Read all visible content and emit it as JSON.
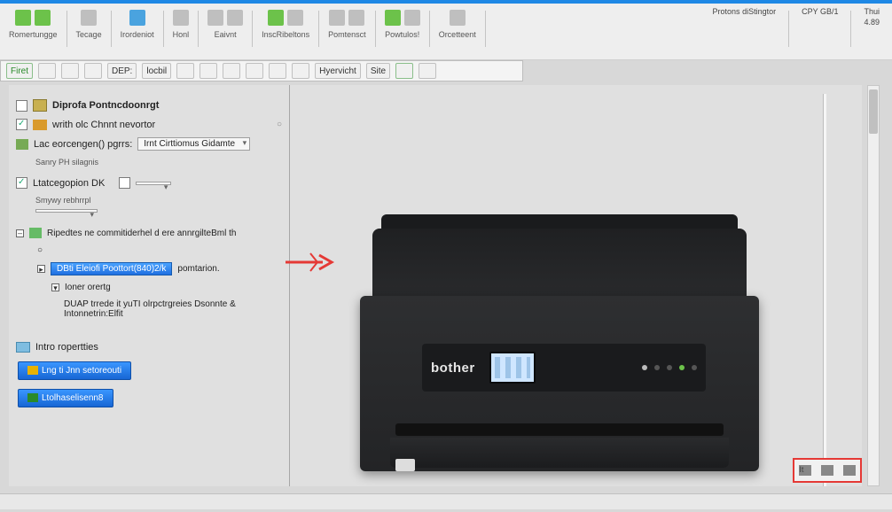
{
  "ribbon1": {
    "groups": [
      {
        "label": "Romertungge"
      },
      {
        "label": "Tecage"
      },
      {
        "label": "Irordeniot"
      },
      {
        "label": "Honl"
      },
      {
        "label": "Eaivnt"
      },
      {
        "label": "InscRibeltons"
      },
      {
        "label": "Pomtensct"
      },
      {
        "label": "Powtulos!"
      },
      {
        "label": "Orcetteent"
      }
    ],
    "right_fields": [
      {
        "k": "Protons",
        "v": "diStingtor"
      },
      {
        "k": "CPY",
        "v": "GB/1"
      },
      {
        "k": "Thui",
        "v": "4.89"
      }
    ]
  },
  "ribbon2": {
    "items": [
      "Firet",
      "",
      "",
      "",
      "DEP:",
      "locbil",
      "",
      "",
      "",
      "",
      "",
      "",
      "Hyervicht",
      "Site",
      ""
    ]
  },
  "panel": {
    "header": "Diprofa Pontncdoonrgt",
    "l1": "writh olc Chnnt nevortor",
    "l2": "Lac eorcengen() pgrrs:",
    "l2_sub": "Sanry PH silagnis",
    "l2_dd": "Irnt Cirttiomus Gidamte",
    "l3": "Ltatcegopion DK",
    "l3_sub": "Smywy rebhrrpl",
    "tree_head": "Ripedtes ne commitiderhel d ere annrgilteBml th",
    "tree_sel": "DBti Eleiofi Poottort(840)2/k",
    "tree_sel_tail": "pomtarion.",
    "tree_sub1": "Ioner orertg",
    "tree_sub2": "DUAP trrede it yuTI olrpctrgreies Dsonnte &",
    "tree_sub3": "Intonnetrin:Elfit",
    "info": "Intro ropertties",
    "btn1": "Lng ti Jnn setoreouti",
    "btn2": "Ltolhaselisenn8"
  },
  "printer": {
    "brand": "bother"
  },
  "br": {
    "a": "It",
    "b": "",
    "c": ""
  }
}
